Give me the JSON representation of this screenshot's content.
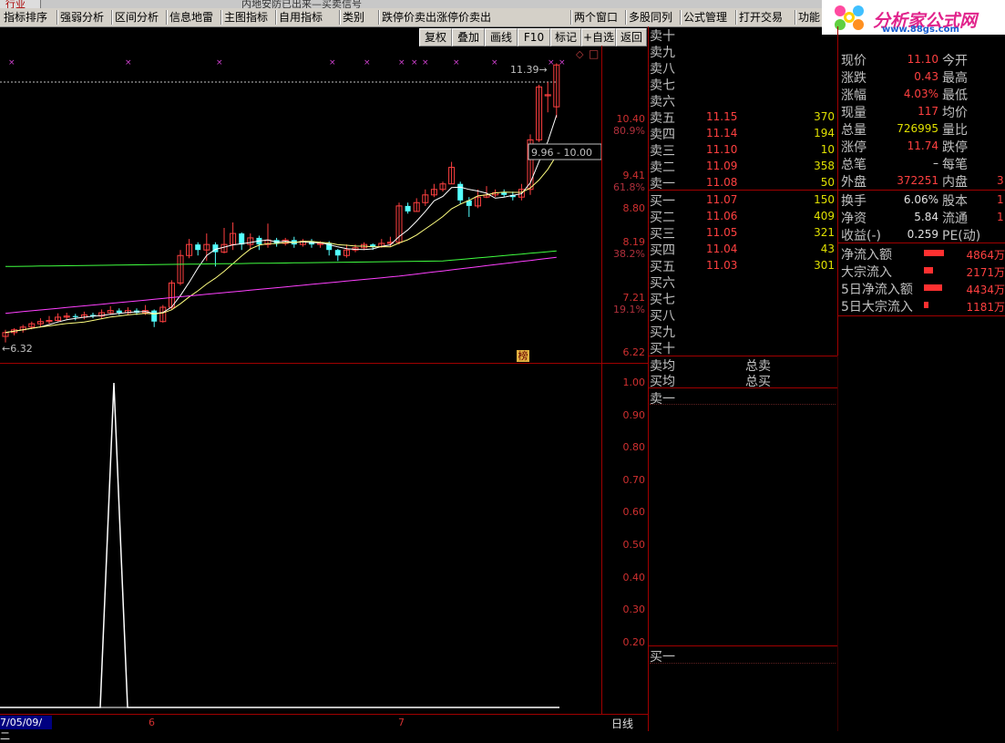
{
  "window": {
    "left_tab": "行业",
    "title": "内地安防已出来—买卖信号"
  },
  "menu": [
    {
      "label": "指标排序"
    },
    {
      "label": "强弱分析"
    },
    {
      "label": "区间分析"
    },
    {
      "label": "信息地雷"
    },
    {
      "label": "主图指标"
    },
    {
      "label": "自用指标"
    },
    {
      "label": "类别"
    },
    {
      "label": "跌停价卖出涨停价卖出"
    },
    {
      "label": "两个窗口"
    },
    {
      "label": "多股同列"
    },
    {
      "label": "公式管理"
    },
    {
      "label": "打开交易"
    },
    {
      "label": "功能"
    }
  ],
  "logo": {
    "text": "分析家公式网",
    "url": "www.88gs.com"
  },
  "toolbar": [
    {
      "label": "复权"
    },
    {
      "label": "叠加"
    },
    {
      "label": "画线"
    },
    {
      "label": "F10"
    },
    {
      "label": "标记"
    },
    {
      "label": "+自选"
    },
    {
      "label": "返回"
    }
  ],
  "main_chart": {
    "price_axis": [
      {
        "value": "10.40",
        "pct": "80.9%"
      },
      {
        "value": "9.41",
        "pct": "61.8%"
      },
      {
        "value": "8.80",
        "pct": ""
      },
      {
        "value": "8.19",
        "pct": "38.2%"
      },
      {
        "value": "7.21",
        "pct": "19.1%"
      },
      {
        "value": "6.22",
        "pct": ""
      }
    ],
    "high_marker": "11.39",
    "low_marker": "6.32",
    "range_label": "9.96 - 10.00",
    "badge": "榜",
    "symbols": {
      "diamond": "◇",
      "box": "□"
    }
  },
  "indicator_axis": [
    "1.00",
    "0.90",
    "0.80",
    "0.70",
    "0.60",
    "0.50",
    "0.40",
    "0.30",
    "0.20"
  ],
  "date_axis": {
    "start": "7/05/09/二",
    "m1": "6",
    "m2": "7",
    "period": "日线"
  },
  "order_book": {
    "sells": [
      {
        "label": "卖十",
        "price": "",
        "vol": ""
      },
      {
        "label": "卖九",
        "price": "",
        "vol": ""
      },
      {
        "label": "卖八",
        "price": "",
        "vol": ""
      },
      {
        "label": "卖七",
        "price": "",
        "vol": ""
      },
      {
        "label": "卖六",
        "price": "",
        "vol": ""
      },
      {
        "label": "卖五",
        "price": "11.15",
        "vol": "370"
      },
      {
        "label": "卖四",
        "price": "11.14",
        "vol": "194"
      },
      {
        "label": "卖三",
        "price": "11.10",
        "vol": "10"
      },
      {
        "label": "卖二",
        "price": "11.09",
        "vol": "358"
      },
      {
        "label": "卖一",
        "price": "11.08",
        "vol": "50"
      }
    ],
    "buys": [
      {
        "label": "买一",
        "price": "11.07",
        "vol": "150"
      },
      {
        "label": "买二",
        "price": "11.06",
        "vol": "409"
      },
      {
        "label": "买三",
        "price": "11.05",
        "vol": "321"
      },
      {
        "label": "买四",
        "price": "11.04",
        "vol": "43"
      },
      {
        "label": "买五",
        "price": "11.03",
        "vol": "301"
      },
      {
        "label": "买六",
        "price": "",
        "vol": ""
      },
      {
        "label": "买七",
        "price": "",
        "vol": ""
      },
      {
        "label": "买八",
        "price": "",
        "vol": ""
      },
      {
        "label": "买九",
        "price": "",
        "vol": ""
      },
      {
        "label": "买十",
        "price": "",
        "vol": ""
      }
    ],
    "sell_avg": "卖均",
    "buy_avg": "买均",
    "total_sell": "总卖",
    "total_buy": "总买",
    "detail_sell1": "卖一",
    "detail_buy1": "买一"
  },
  "stats": {
    "rows": [
      {
        "l1": "现价",
        "v1": "11.10",
        "c1": "#ff4040",
        "l2": "今开",
        "v2": ""
      },
      {
        "l1": "涨跌",
        "v1": "0.43",
        "c1": "#ff4040",
        "l2": "最高",
        "v2": ""
      },
      {
        "l1": "涨幅",
        "v1": "4.03%",
        "c1": "#ff4040",
        "l2": "最低",
        "v2": ""
      },
      {
        "l1": "现量",
        "v1": "117",
        "c1": "#ff4040",
        "l2": "均价",
        "v2": ""
      },
      {
        "l1": "总量",
        "v1": "726995",
        "c1": "#e0e000",
        "l2": "量比",
        "v2": ""
      },
      {
        "l1": "涨停",
        "v1": "11.74",
        "c1": "#ff4040",
        "l2": "跌停",
        "v2": ""
      },
      {
        "l1": "总笔",
        "v1": "–",
        "c1": "#e0e0e0",
        "l2": "每笔",
        "v2": ""
      },
      {
        "l1": "外盘",
        "v1": "372251",
        "c1": "#ff4040",
        "l2": "内盘",
        "v2": "3"
      }
    ],
    "rows2": [
      {
        "l1": "换手",
        "v1": "6.06%",
        "c1": "#e0e0e0",
        "l2": "股本",
        "v2": "1"
      },
      {
        "l1": "净资",
        "v1": "5.84",
        "c1": "#e0e0e0",
        "l2": "流通",
        "v2": "1"
      },
      {
        "l1": "收益(-)",
        "v1": "0.259",
        "c1": "#e0e0e0",
        "l2": "PE(动)",
        "v2": ""
      }
    ],
    "flows": [
      {
        "label": "净流入额",
        "value": "4864万",
        "bar": 0.9
      },
      {
        "label": "大宗流入",
        "value": "2171万",
        "bar": 0.4
      },
      {
        "label": "5日净流入额",
        "value": "4434万",
        "bar": 0.82
      },
      {
        "label": "5日大宗流入",
        "value": "1181万",
        "bar": 0.2
      }
    ]
  },
  "colors": {
    "up": "#ff4040",
    "down": "#54ffff",
    "ma5": "#ffffff",
    "ma10": "#ffff80",
    "ma30": "#40ff40",
    "ma60": "#ff40ff"
  }
}
